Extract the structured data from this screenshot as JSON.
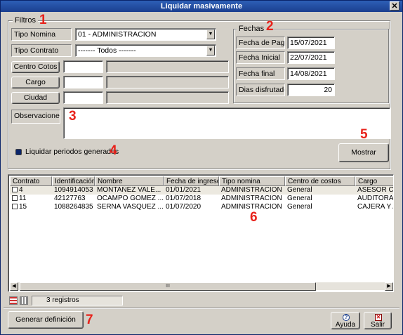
{
  "window": {
    "title": "Liquidar masivamente",
    "close_glyph": "✕"
  },
  "filtros": {
    "legend": "Filtros",
    "tipo_nomina_label": "Tipo Nomina",
    "tipo_nomina_value": "01 - ADMINISTRACION",
    "tipo_contrato_label": "Tipo Contrato",
    "tipo_contrato_value": "------- Todos -------",
    "centro_costos_button": "Centro Cotos",
    "cargo_button": "Cargo",
    "ciudad_button": "Ciudad",
    "centro_costos_code": "",
    "centro_costos_desc": "",
    "cargo_code": "",
    "cargo_desc": "",
    "ciudad_code": "",
    "ciudad_desc": "",
    "observaciones_label": "Observaciones",
    "observaciones_value": "",
    "liquidar_label": "Liquidar periodos generados",
    "mostrar_button": "Mostrar"
  },
  "fechas": {
    "legend": "Fechas",
    "fecha_pago_label": "Fecha de Pago",
    "fecha_pago_value": "15/07/2021",
    "fecha_inicial_label": "Fecha Inicial",
    "fecha_inicial_value": "22/07/2021",
    "fecha_final_label": "Fecha final",
    "fecha_final_value": "14/08/2021",
    "dias_label": "Dias disfrutados",
    "dias_value": "20"
  },
  "grid": {
    "columns": [
      "Contrato",
      "Identificación",
      "Nombre",
      "Fecha de ingreso",
      "Tipo nomina",
      "Centro de costos",
      "Cargo"
    ],
    "rows": [
      [
        "4",
        "1094914053",
        "MONTAÑEZ VALE...",
        "01/01/2021",
        "ADMINISTRACION",
        "General",
        "ASESOR CO"
      ],
      [
        "11",
        "42127763",
        "OCAMPO GOMEZ ...",
        "01/07/2018",
        "ADMINISTRACION",
        "General",
        "AUDITORA C"
      ],
      [
        "15",
        "1088264835",
        "SERNA VASQUEZ ...",
        "01/07/2020",
        "ADMINISTRACION",
        "General",
        "CAJERA Y A"
      ]
    ],
    "scroll_thumb_glyph": "III"
  },
  "status": {
    "count_text": "3 registros"
  },
  "footer": {
    "generar_button": "Generar definición",
    "ayuda_button": "Ayuda",
    "salir_button": "Salir"
  },
  "annotations": [
    "1",
    "2",
    "3",
    "4",
    "5",
    "6",
    "7"
  ],
  "colors": {
    "title_bar": "#1b3f8f",
    "annotation": "#e8221b",
    "dialog_bg": "#d4d0c8"
  }
}
